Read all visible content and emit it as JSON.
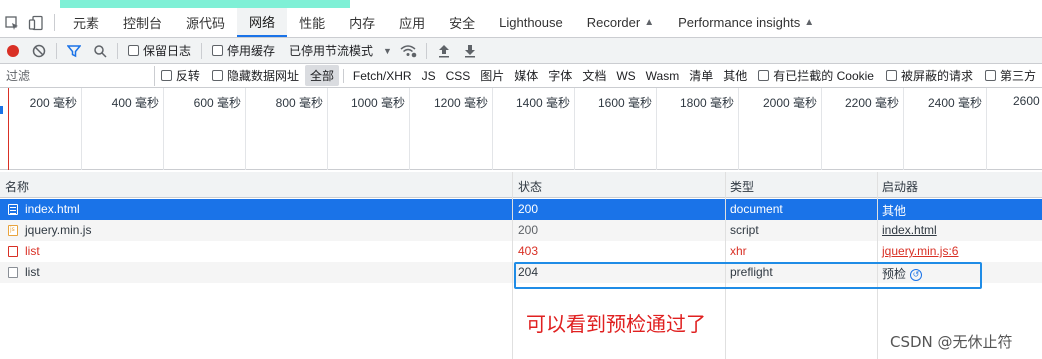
{
  "tabs": [
    {
      "label": "元素",
      "active": false
    },
    {
      "label": "控制台",
      "active": false
    },
    {
      "label": "源代码",
      "active": false
    },
    {
      "label": "网络",
      "active": true
    },
    {
      "label": "性能",
      "active": false
    },
    {
      "label": "内存",
      "active": false
    },
    {
      "label": "应用",
      "active": false
    },
    {
      "label": "安全",
      "active": false
    },
    {
      "label": "Lighthouse",
      "active": false
    },
    {
      "label": "Recorder",
      "active": false,
      "experimental": true
    },
    {
      "label": "Performance insights",
      "active": false,
      "experimental": true
    }
  ],
  "toolbar": {
    "preserve_log": "保留日志",
    "disable_cache": "停用缓存",
    "throttling": "已停用节流模式",
    "icons": [
      "record-icon",
      "clear-icon",
      "filter-icon",
      "search-icon",
      "wifi-settings-icon",
      "import-icon",
      "export-icon"
    ]
  },
  "filterbar": {
    "placeholder": "过滤",
    "invert": "反转",
    "hide_data_urls": "隐藏数据网址",
    "types": [
      "全部",
      "Fetch/XHR",
      "JS",
      "CSS",
      "图片",
      "媒体",
      "字体",
      "文档",
      "WS",
      "Wasm",
      "清单",
      "其他"
    ],
    "active_type": "全部",
    "blocked_cookies": "有已拦截的 Cookie",
    "blocked_requests": "被屏蔽的请求",
    "third_party": "第三方"
  },
  "overview": {
    "ticks": [
      "200 毫秒",
      "400 毫秒",
      "600 毫秒",
      "800 毫秒",
      "1000 毫秒",
      "1200 毫秒",
      "1400 毫秒",
      "1600 毫秒",
      "1800 毫秒",
      "2000 毫秒",
      "2200 毫秒",
      "2400 毫秒",
      "2600"
    ]
  },
  "table": {
    "headers": {
      "name": "名称",
      "status": "状态",
      "type": "类型",
      "initiator": "启动器"
    },
    "rows": [
      {
        "name": "index.html",
        "status": "200",
        "type": "document",
        "initiator": "其他"
      },
      {
        "name": "jquery.min.js",
        "status": "200",
        "type": "script",
        "initiator": "index.html"
      },
      {
        "name": "list",
        "status": "403",
        "type": "xhr",
        "initiator": "jquery.min.js:6"
      },
      {
        "name": "list",
        "status": "204",
        "type": "preflight",
        "initiator": "预检"
      }
    ]
  },
  "annotation": "可以看到预检通过了",
  "watermark": "CSDN @无休止符",
  "colors": {
    "accent": "#1a73e8",
    "error": "#d93025",
    "annotation": "#e02020",
    "highlight": "#1f8ce6"
  }
}
